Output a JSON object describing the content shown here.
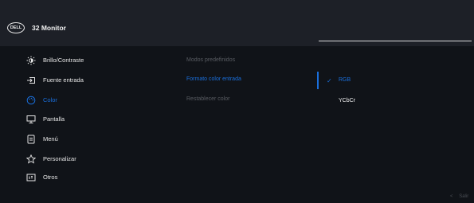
{
  "header": {
    "logo_text": "DELL",
    "title": "32 Monitor"
  },
  "menu": [
    {
      "label": "Brillo/Contraste",
      "icon": "brightness-icon"
    },
    {
      "label": "Fuente entrada",
      "icon": "input-source-icon"
    },
    {
      "label": "Color",
      "icon": "color-palette-icon",
      "active": true
    },
    {
      "label": "Pantalla",
      "icon": "display-icon"
    },
    {
      "label": "Menú",
      "icon": "menu-icon"
    },
    {
      "label": "Personalizar",
      "icon": "star-icon"
    },
    {
      "label": "Otros",
      "icon": "others-icon"
    }
  ],
  "submenu": [
    {
      "label": "Modos predefinidos",
      "state": "dim"
    },
    {
      "label": "Formato color entrada",
      "state": "active"
    },
    {
      "label": "Restablecer color",
      "state": "dim"
    }
  ],
  "options": [
    {
      "label": "RGB",
      "selected": true
    },
    {
      "label": "YCbCr",
      "selected": false
    }
  ],
  "footer": {
    "exit_label": "Salir"
  },
  "colors": {
    "accent": "#1a6fdc",
    "background": "#101318",
    "header": "#1d2027",
    "dim_text": "#595c62"
  }
}
